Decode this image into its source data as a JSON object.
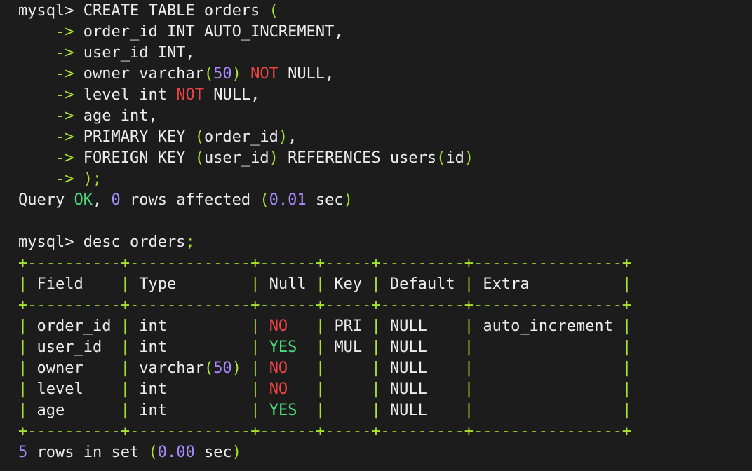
{
  "terminal": {
    "prompt": "mysql>",
    "continuation": "->",
    "create": {
      "command": "CREATE TABLE orders",
      "lines": [
        "order_id INT AUTO_INCREMENT,",
        "user_id INT,",
        "owner varchar",
        "50",
        "NOT",
        "NULL,",
        "level int",
        "NOT",
        "NULL,",
        "age int,",
        "PRIMARY KEY",
        "order_id",
        "),",
        "FOREIGN KEY",
        "user_id",
        "REFERENCES users",
        "id",
        ");"
      ],
      "result": {
        "query": "Query",
        "ok": "OK",
        "count": "0",
        "text": "rows affected",
        "time": "0.01",
        "sec": "sec"
      }
    },
    "desc": {
      "command": "desc orders",
      "semicolon": ";",
      "columns": [
        "Field",
        "Type",
        "Null",
        "Key",
        "Default",
        "Extra"
      ],
      "rows": [
        [
          "order_id",
          "int",
          "NO",
          "PRI",
          "NULL",
          "auto_increment"
        ],
        [
          "user_id",
          "int",
          "YES",
          "MUL",
          "NULL",
          ""
        ],
        [
          "owner",
          "varchar(50)",
          "NO",
          "",
          "NULL",
          ""
        ],
        [
          "level",
          "int",
          "NO",
          "",
          "NULL",
          ""
        ],
        [
          "age",
          "int",
          "YES",
          "",
          "NULL",
          ""
        ]
      ],
      "result": {
        "count": "5",
        "text": "rows in set",
        "time": "0.00",
        "sec": "sec"
      }
    },
    "colors": {
      "background": "#1c1c1c",
      "text": "#ececec",
      "border": "#a6e22e",
      "no": "#ef4444",
      "yes": "#4ade80",
      "number": "#a78bfa"
    }
  }
}
